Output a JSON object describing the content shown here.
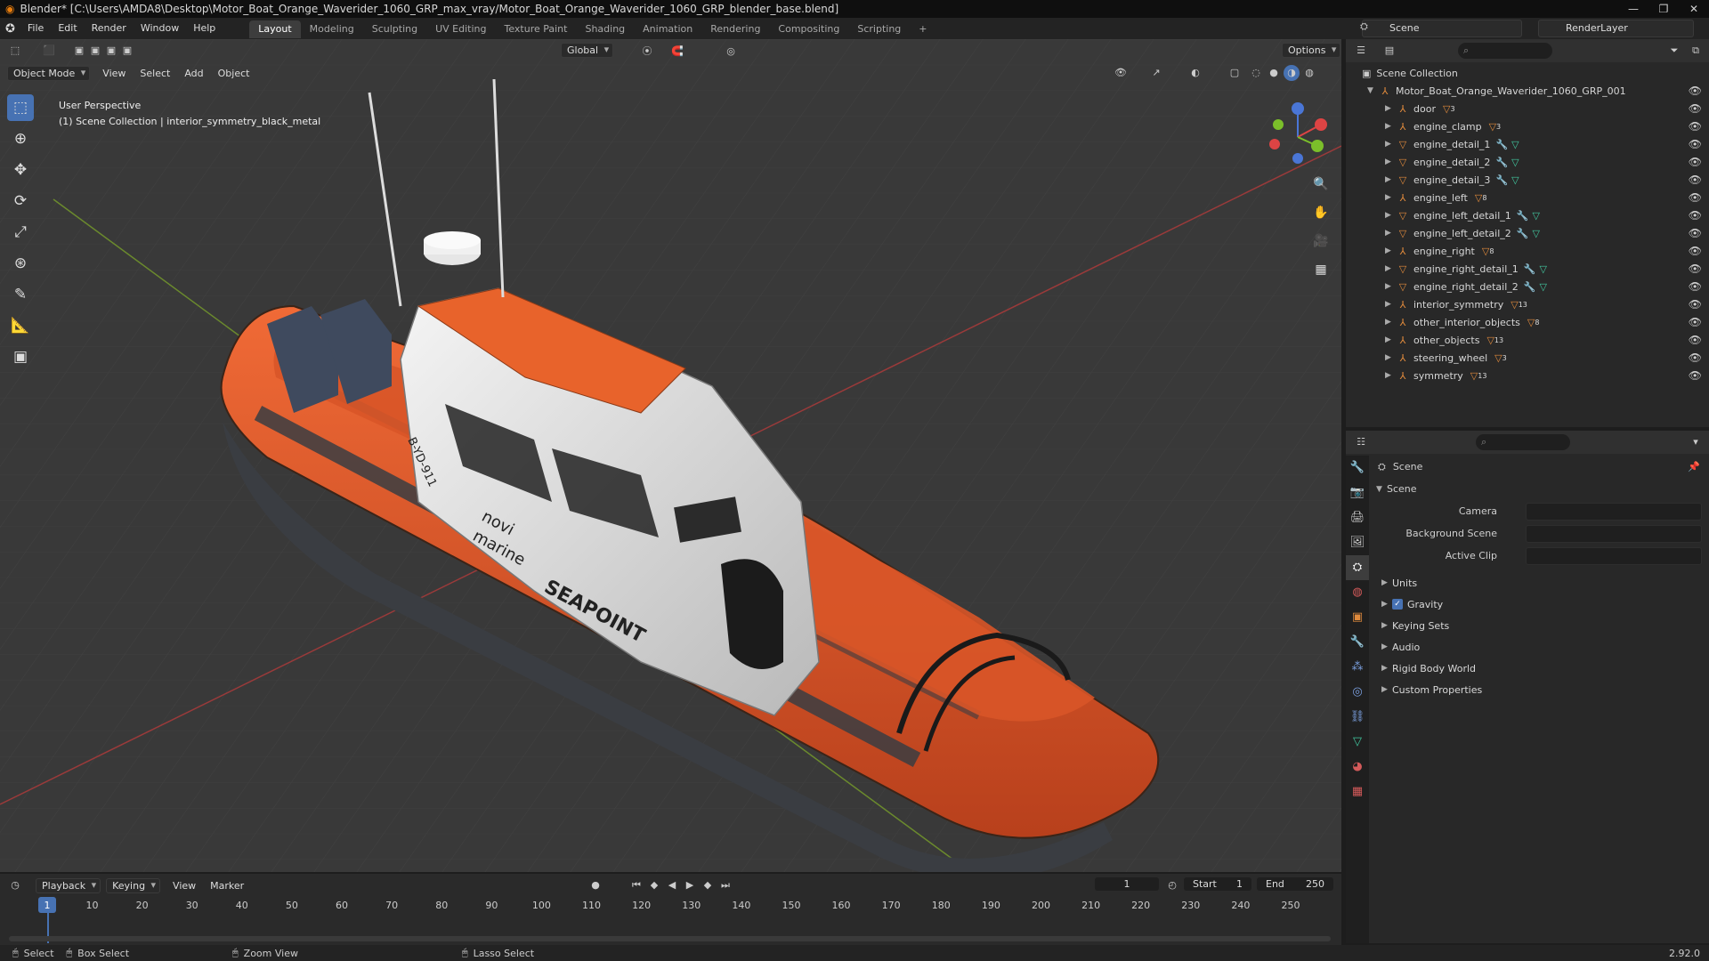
{
  "window_title": "Blender* [C:\\Users\\AMDA8\\Desktop\\Motor_Boat_Orange_Waverider_1060_GRP_max_vray/Motor_Boat_Orange_Waverider_1060_GRP_blender_base.blend]",
  "menu": [
    "File",
    "Edit",
    "Render",
    "Window",
    "Help"
  ],
  "workspaces": [
    "Layout",
    "Modeling",
    "Sculpting",
    "UV Editing",
    "Texture Paint",
    "Shading",
    "Animation",
    "Rendering",
    "Compositing",
    "Scripting"
  ],
  "active_workspace": "Layout",
  "scene_name": "Scene",
  "render_layer": "RenderLayer",
  "viewport": {
    "mode": "Object Mode",
    "menus": [
      "View",
      "Select",
      "Add",
      "Object"
    ],
    "orientation": "Global",
    "options_label": "Options",
    "perspective_label": "User Perspective",
    "collection_label": "(1) Scene Collection | interior_symmetry_black_metal",
    "boat_text": {
      "hull_brand": "SEAPOINT",
      "cabin_brand_1": "novi",
      "cabin_brand_2": "marine",
      "reg": "B-YD-911"
    }
  },
  "outliner": {
    "root": "Scene Collection",
    "group": "Motor_Boat_Orange_Waverider_1060_GRP_001",
    "items": [
      {
        "name": "door",
        "kind": "empty",
        "badge": "3"
      },
      {
        "name": "engine_clamp",
        "kind": "empty",
        "badge": "3"
      },
      {
        "name": "engine_detail_1",
        "kind": "mesh",
        "badge": ""
      },
      {
        "name": "engine_detail_2",
        "kind": "mesh",
        "badge": ""
      },
      {
        "name": "engine_detail_3",
        "kind": "mesh",
        "badge": ""
      },
      {
        "name": "engine_left",
        "kind": "empty",
        "badge": "8"
      },
      {
        "name": "engine_left_detail_1",
        "kind": "mesh",
        "badge": ""
      },
      {
        "name": "engine_left_detail_2",
        "kind": "mesh",
        "badge": ""
      },
      {
        "name": "engine_right",
        "kind": "empty",
        "badge": "8"
      },
      {
        "name": "engine_right_detail_1",
        "kind": "mesh",
        "badge": ""
      },
      {
        "name": "engine_right_detail_2",
        "kind": "mesh",
        "badge": ""
      },
      {
        "name": "interior_symmetry",
        "kind": "empty",
        "badge": "13"
      },
      {
        "name": "other_interior_objects",
        "kind": "empty",
        "badge": "8"
      },
      {
        "name": "other_objects",
        "kind": "empty",
        "badge": "13"
      },
      {
        "name": "steering_wheel",
        "kind": "empty",
        "badge": "3"
      },
      {
        "name": "symmetry",
        "kind": "empty",
        "badge": "13"
      }
    ]
  },
  "properties": {
    "context": "Scene",
    "panel": "Scene",
    "fields": [
      {
        "label": "Camera"
      },
      {
        "label": "Background Scene"
      },
      {
        "label": "Active Clip"
      }
    ],
    "subpanels": [
      "Units",
      "Gravity",
      "Keying Sets",
      "Audio",
      "Rigid Body World",
      "Custom Properties"
    ],
    "gravity_checked": true
  },
  "timeline": {
    "menus": [
      "Playback",
      "Keying",
      "View",
      "Marker"
    ],
    "current_frame": "1",
    "start_label": "Start",
    "start": "1",
    "end_label": "End",
    "end": "250",
    "ruler": [
      "1",
      "10",
      "20",
      "30",
      "40",
      "50",
      "60",
      "70",
      "80",
      "90",
      "100",
      "110",
      "120",
      "130",
      "140",
      "150",
      "160",
      "170",
      "180",
      "190",
      "200",
      "210",
      "220",
      "230",
      "240",
      "250"
    ]
  },
  "statusbar": {
    "items": [
      "Select",
      "Box Select",
      "Zoom View",
      "Lasso Select"
    ],
    "version": "2.92.0"
  },
  "colors": {
    "accent": "#4772b3",
    "hull_orange": "#e8582a",
    "tube_dark": "#3a3d42",
    "grid_red": "#9a3a3a",
    "grid_green": "#6b8a2d"
  }
}
